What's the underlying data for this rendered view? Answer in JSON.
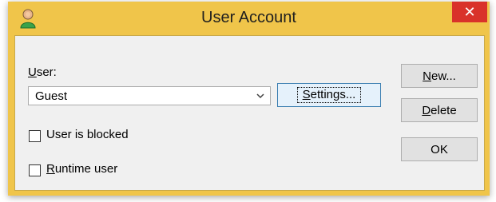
{
  "window": {
    "title": "User Account",
    "close_glyph": "✕",
    "icon": "user-icon"
  },
  "form": {
    "user_label": "User:",
    "user_label_mnemonic": "U",
    "user_label_rest": "ser:",
    "user_value": "Guest",
    "settings_button": "Settings...",
    "settings_mnemonic": "S",
    "settings_rest": "ettings...",
    "blocked_label": "User is blocked",
    "blocked_checked": false,
    "runtime_label": "Runtime user",
    "runtime_mnemonic": "R",
    "runtime_rest": "untime user",
    "runtime_checked": false
  },
  "buttons": {
    "new_mnemonic": "N",
    "new_rest": "ew...",
    "delete_mnemonic": "D",
    "delete_rest": "elete",
    "ok": "OK"
  },
  "colors": {
    "titlebar": "#f0c54a",
    "close": "#d9322a",
    "client": "#f0f0f0"
  }
}
